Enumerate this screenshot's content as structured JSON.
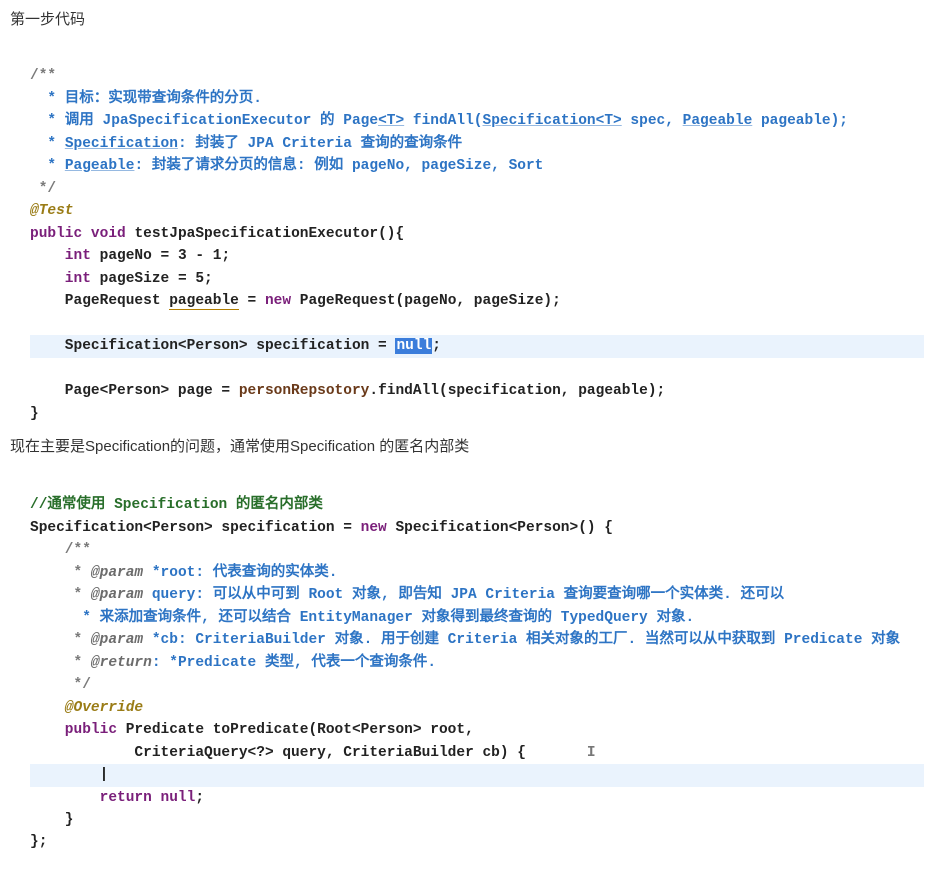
{
  "heading1": "第一步代码",
  "code1": {
    "c0": "/**",
    "c1_a": " * 目标：实现带查询条件的分页.",
    "c2_a": " * 调用 JpaSpecificationExecutor ",
    "c2_b": "的",
    "c2_c": " Page",
    "c2_d": "<T>",
    "c2_e": " findAll(",
    "c2_f": "Specification",
    "c2_g": "<T>",
    "c2_h": " spec, ",
    "c2_i": "Pageable",
    "c2_j": " pageable);",
    "c3_a": " * ",
    "c3_b": "Specification",
    "c3_c": ": 封装了 JPA Criteria 查询的查询条件",
    "c4_a": " * ",
    "c4_b": "Pageable",
    "c4_c": ": 封装了请求分页的信息: 例如 pageNo, pageSize, Sort",
    "c5": " */",
    "a1": "@Test",
    "l1_a": "public ",
    "l1_b": "void ",
    "l1_c": "testJpaSpecificationExecutor(){",
    "l2_a": "    int ",
    "l2_b": "pageNo = 3 - 1;",
    "l3_a": "    int ",
    "l3_b": "pageSize = 5;",
    "l4_a": "    PageRequest ",
    "l4_b": "pageable",
    "l4_c": " = ",
    "l4_d": "new ",
    "l4_e": "PageRequest(pageNo, pageSize);",
    "l5_a": "    Specification<Person> specification = ",
    "l5_sel": "null",
    "l5_b": ";",
    "l6_a": "    Page<Person> page = ",
    "l6_b": "personRepsotory",
    "l6_c": ".findAll(specification, pageable);",
    "l7": "}"
  },
  "prose1": "现在主要是Specification的问题，通常使用Specification 的匿名内部类",
  "code2": {
    "c0": "//通常使用 Specification 的匿名内部类",
    "l1_a": "Specification<Person> specification = ",
    "l1_b": "new ",
    "l1_c": "Specification<Person>() {",
    "d0": "    /**",
    "d1_a": "     * ",
    "d1_t": "@param",
    "d1_b": " *root: 代表查询的实体类. ",
    "d2_a": "     * ",
    "d2_t": "@param",
    "d2_b": " query: 可以从中可到 Root 对象, 即告知 JPA Criteria 查询要查询哪一个实体类. 还可以",
    "d3": "     * 来添加查询条件, 还可以结合 EntityManager 对象得到最终查询的 TypedQuery 对象. ",
    "d4_a": "     * ",
    "d4_t": "@param",
    "d4_b": " *cb: CriteriaBuilder 对象. 用于创建 Criteria 相关对象的工厂. 当然可以从中获取到 Predicate 对象",
    "d5_a": "     * ",
    "d5_t": "@return",
    "d5_b": ": *Predicate 类型, 代表一个查询条件. ",
    "d6": "     */",
    "a2": "    @Override",
    "m1_a": "    public ",
    "m1_b": "Predicate toPredicate(Root<Person> root,",
    "m2": "            CriteriaQuery<?> query, CriteriaBuilder cb) {",
    "caret": "       I",
    "hl": "        |",
    "m3_a": "        return ",
    "m3_b": "null",
    "m3_c": ";",
    "m4": "    }",
    "m5": "};"
  }
}
